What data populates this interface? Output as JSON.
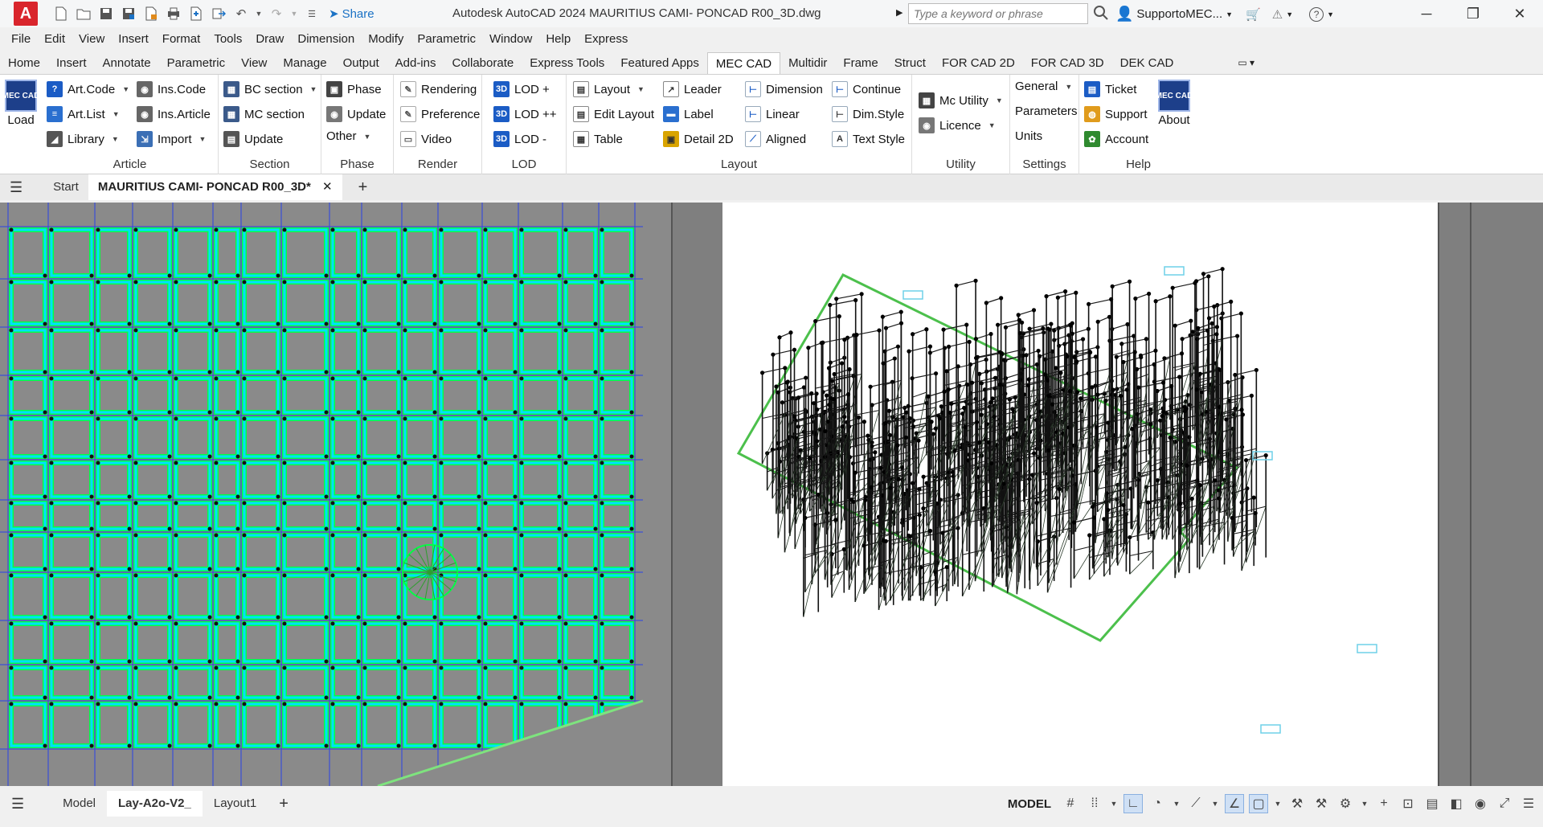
{
  "titlebar": {
    "logo": "A",
    "share": "Share",
    "title": "Autodesk AutoCAD 2024   MAURITIUS CAMI- PONCAD R00_3D.dwg",
    "search_placeholder": "Type a keyword or phrase",
    "user": "SupportoMEC...",
    "icons": [
      "new-icon",
      "open-icon",
      "save-icon",
      "save-as-icon",
      "publish-icon",
      "print-icon",
      "plot-icon",
      "share-view-icon",
      "undo-icon",
      "redo-icon",
      "workspace-icon"
    ]
  },
  "menu": [
    "File",
    "Edit",
    "View",
    "Insert",
    "Format",
    "Tools",
    "Draw",
    "Dimension",
    "Modify",
    "Parametric",
    "Window",
    "Help",
    "Express"
  ],
  "ribbon_tabs": [
    "Home",
    "Insert",
    "Annotate",
    "Parametric",
    "View",
    "Manage",
    "Output",
    "Add-ins",
    "Collaborate",
    "Express Tools",
    "Featured Apps",
    "MEC CAD",
    "Multidir",
    "Frame",
    "Struct",
    "FOR CAD 2D",
    "FOR CAD 3D",
    "DEK CAD"
  ],
  "ribbon_active": "MEC CAD",
  "ribbon": {
    "load": {
      "logo": "MEC CAD",
      "label": "Load"
    },
    "article": {
      "label": "Article",
      "b1": "Art.Code",
      "b2": "Art.List",
      "b3": "Library",
      "b4": "Ins.Code",
      "b5": "Ins.Article",
      "b6": "Import"
    },
    "section": {
      "label": "Section",
      "b1": "BC section",
      "b2": "MC section",
      "b3": "Update"
    },
    "phase": {
      "label": "Phase",
      "b1": "Phase",
      "b2": "Update",
      "b3": "Other"
    },
    "render": {
      "label": "Render",
      "b1": "Rendering",
      "b2": "Preference",
      "b3": "Video"
    },
    "lod": {
      "label": "LOD",
      "b1": "LOD +",
      "b2": "LOD ++",
      "b3": "LOD -"
    },
    "layout": {
      "label": "Layout",
      "b1": "Layout",
      "b2": "Edit Layout",
      "b3": "Table",
      "b4": "Leader",
      "b5": "Label",
      "b6": "Detail 2D",
      "b7": "Dimension",
      "b8": "Linear",
      "b9": "Aligned",
      "b10": "Continue",
      "b11": "Dim.Style",
      "b12": "Text Style"
    },
    "utility": {
      "label": "Utility",
      "b1": "Mc Utility",
      "b2": "Licence"
    },
    "settings": {
      "label": "Settings",
      "b1": "General",
      "b2": "Parameters",
      "b3": "Units"
    },
    "help": {
      "label": "Help",
      "b1": "Ticket",
      "b2": "Support",
      "b3": "Account",
      "about_logo": "MEC CAD",
      "about": "About"
    }
  },
  "doc_tabs": {
    "start": "Start",
    "active": "MAURITIUS CAMI- PONCAD R00_3D*"
  },
  "layout_tabs": {
    "t1": "Model",
    "t2": "Lay-A2o-V2_",
    "t3": "Layout1"
  },
  "status": {
    "model": "MODEL"
  },
  "colors": {
    "beam": "#00e0ff",
    "column_border": "#00ff44",
    "axis": "#3a4fd8",
    "accent": "#1b72c5"
  }
}
